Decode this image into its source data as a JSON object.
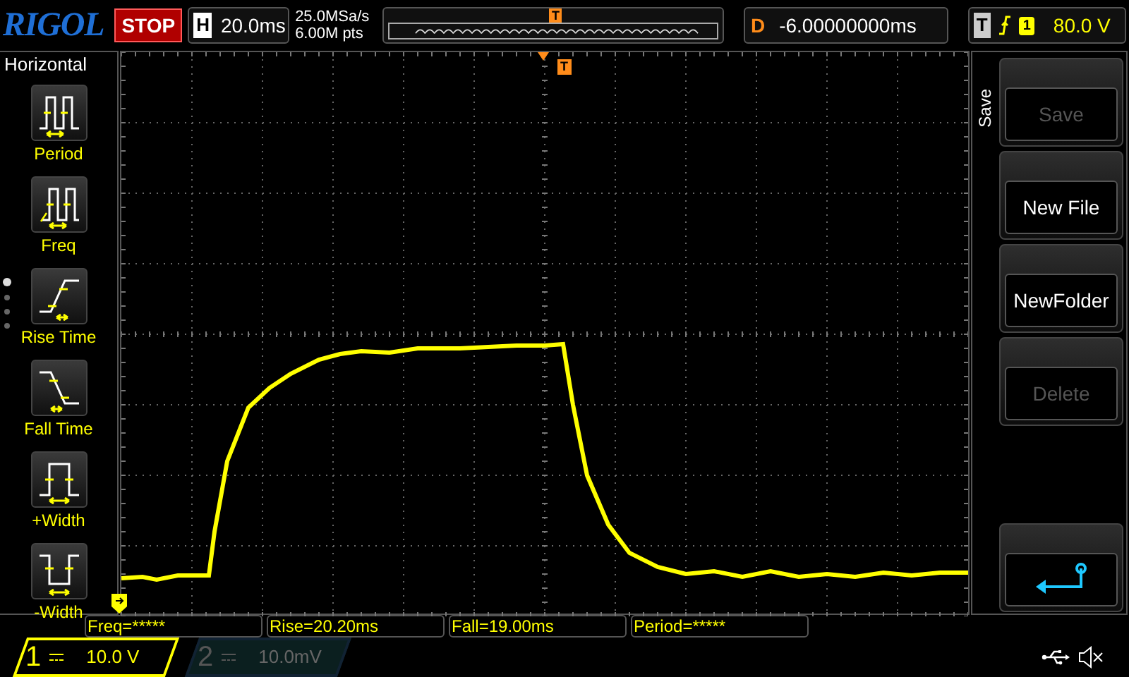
{
  "top_bar": {
    "brand": "RIGOL",
    "run_state": "STOP",
    "horizontal": {
      "label": "H",
      "timebase": "20.0ms"
    },
    "sample_rate": "25.0MSa/s",
    "memory_depth": "6.00M pts",
    "trigger_marker": "T",
    "delay": {
      "label": "D",
      "value": "-6.00000000ms"
    },
    "trigger": {
      "label": "T",
      "channel": "1",
      "level": "80.0 V"
    }
  },
  "left_menu": {
    "title": "Horizontal",
    "items": [
      {
        "label": "Period",
        "kind": "period"
      },
      {
        "label": "Freq",
        "kind": "freq"
      },
      {
        "label": "Rise Time",
        "kind": "rise"
      },
      {
        "label": "Fall Time",
        "kind": "fall"
      },
      {
        "label": "+Width",
        "kind": "pwidth"
      },
      {
        "label": "-Width",
        "kind": "nwidth"
      }
    ],
    "pages": [
      {
        "selected": true
      },
      {
        "selected": false
      },
      {
        "selected": false
      },
      {
        "selected": false
      }
    ]
  },
  "scope": {
    "trigger_position_marker": "T"
  },
  "right_menu": {
    "title": "Save",
    "buttons": [
      {
        "kind": "text",
        "label": "Save",
        "disabled": true
      },
      {
        "kind": "text",
        "label": "New File",
        "disabled": false
      },
      {
        "kind": "text",
        "label": "NewFolder",
        "disabled": false
      },
      {
        "kind": "text",
        "label": "Delete",
        "disabled": true
      },
      {
        "kind": "back",
        "disabled": false
      }
    ]
  },
  "measurements": [
    "Freq=*****",
    "Rise=20.20ms",
    "Fall=19.00ms",
    "Period=*****"
  ],
  "channels": [
    {
      "number": "1",
      "scale": "10.0 V",
      "active": true
    },
    {
      "number": "2",
      "scale": "10.0mV",
      "active": false
    }
  ]
}
